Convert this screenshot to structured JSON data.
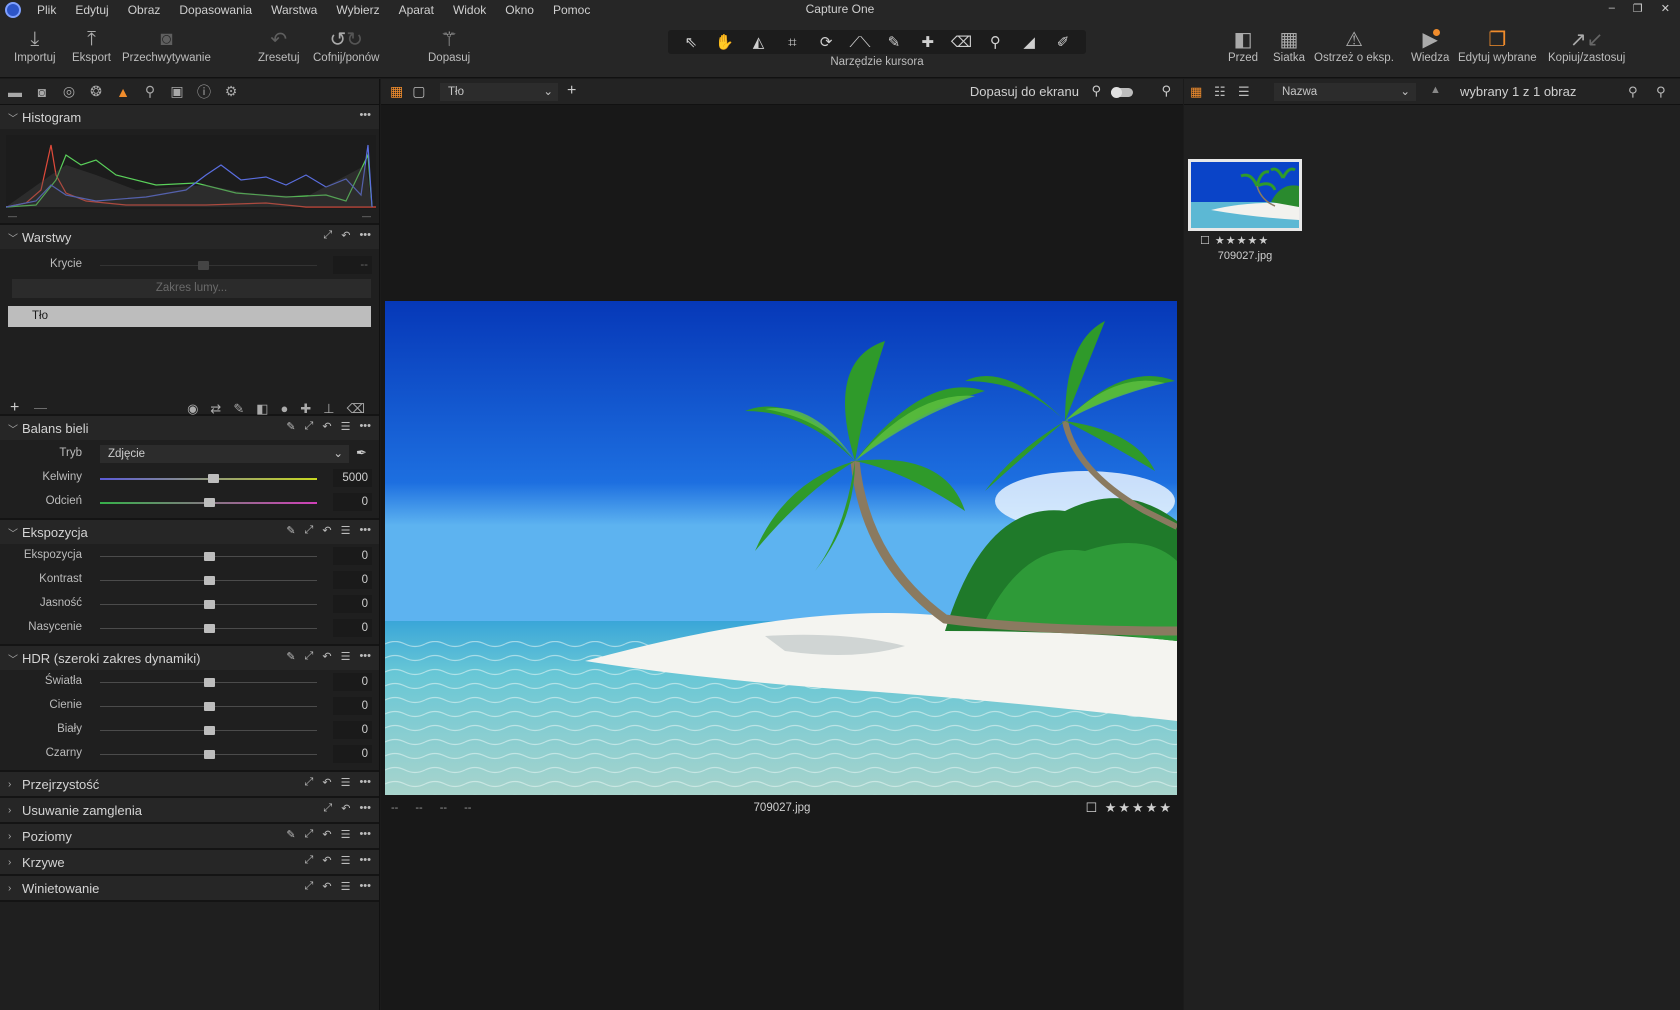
{
  "app": {
    "title": "Capture One"
  },
  "menu": [
    "Plik",
    "Edytuj",
    "Obraz",
    "Dopasowania",
    "Warstwa",
    "Wybierz",
    "Aparat",
    "Widok",
    "Okno",
    "Pomoc"
  ],
  "window_controls": {
    "minimize": "–",
    "restore": "❐",
    "close": "✕"
  },
  "toolbar": {
    "import": "Importuj",
    "export": "Eksport",
    "capture": "Przechwytywanie",
    "reset": "Zresetuj",
    "undo": "Cofnij/ponów",
    "autoadjust": "Dopasuj",
    "cursor_tools_label": "Narzędzie kursora",
    "before": "Przed",
    "grid": "Siatka",
    "exposure_warning": "Ostrzeż o eksp.",
    "learn": "Wiedza",
    "edit_selected": "Edytuj wybrane",
    "copy_apply": "Kopiuj/zastosuj"
  },
  "panels": {
    "histogram": {
      "title": "Histogram",
      "min_marker": "—",
      "max_marker": "—"
    },
    "layers": {
      "title": "Warstwy",
      "opacity_label": "Krycie",
      "opacity_value": "--",
      "luma_range": "Zakres lumy...",
      "background_layer": "Tło",
      "add": "+",
      "remove": "—"
    },
    "white_balance": {
      "title": "Balans bieli",
      "mode_label": "Tryb",
      "mode_value": "Zdjęcie",
      "kelvin_label": "Kelwiny",
      "kelvin_value": "5000",
      "kelvin_level": 0.52,
      "tint_label": "Odcień",
      "tint_value": "0",
      "tint_level": 0.5
    },
    "exposure": {
      "title": "Ekspozycja",
      "rows": [
        {
          "label": "Ekspozycja",
          "value": "0",
          "level": 0.5
        },
        {
          "label": "Kontrast",
          "value": "0",
          "level": 0.5
        },
        {
          "label": "Jasność",
          "value": "0",
          "level": 0.5
        },
        {
          "label": "Nasycenie",
          "value": "0",
          "level": 0.5
        }
      ]
    },
    "hdr": {
      "title": "HDR (szeroki zakres dynamiki)",
      "rows": [
        {
          "label": "Światła",
          "value": "0",
          "level": 0.5
        },
        {
          "label": "Cienie",
          "value": "0",
          "level": 0.5
        },
        {
          "label": "Biały",
          "value": "0",
          "level": 0.5
        },
        {
          "label": "Czarny",
          "value": "0",
          "level": 0.5
        }
      ]
    },
    "clarity": {
      "title": "Przejrzystość"
    },
    "dehaze": {
      "title": "Usuwanie zamglenia"
    },
    "levels": {
      "title": "Poziomy"
    },
    "curves": {
      "title": "Krzywe"
    },
    "vignetting": {
      "title": "Winietowanie"
    }
  },
  "viewer": {
    "layer_select": "Tło",
    "fit_label": "Dopasuj do ekranu",
    "photo_meta_dashes": "-- -- -- --",
    "filename": "709027.jpg",
    "rating": "☐ ★★★★★"
  },
  "browser": {
    "sort_by": "Nazwa",
    "selection_count": "wybrany 1 z 1 obraz",
    "thumb_rating": "☐ ★★★★★",
    "thumb_name": "709027.jpg"
  },
  "colors": {
    "accent": "#f08c2c",
    "panel": "#1f1f1f",
    "header": "#262626"
  }
}
